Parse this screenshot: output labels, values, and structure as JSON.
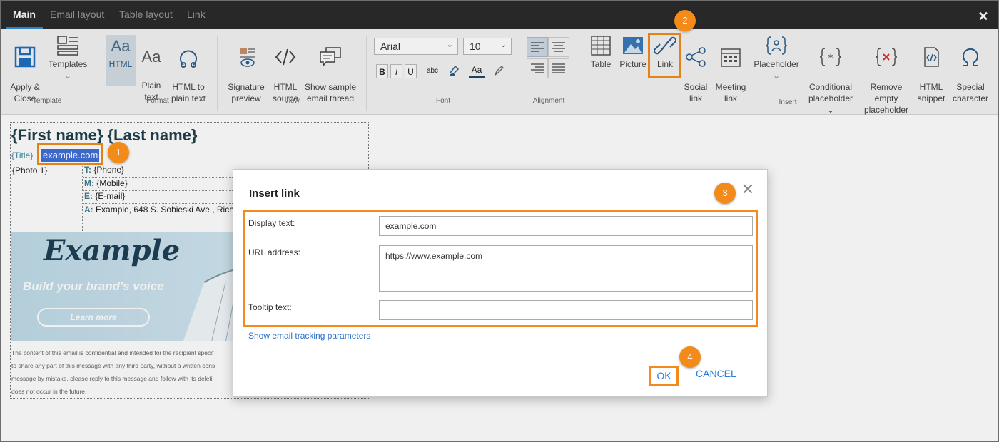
{
  "tabs": [
    {
      "label": "Main"
    },
    {
      "label": "Email layout"
    },
    {
      "label": "Table layout"
    },
    {
      "label": "Link"
    }
  ],
  "close_glyph": "✕",
  "ribbon": {
    "apply_close": "Apply &\nClose",
    "templates": "Templates",
    "templates_caret": "⌄",
    "group_template": "Template",
    "html": "HTML",
    "plain_text": "Plain\ntext",
    "html_to_plain": "HTML to\nplain text",
    "group_format": "Format",
    "signature_preview": "Signature\npreview",
    "html_source": "HTML\nsource",
    "show_sample": "Show sample\nemail thread",
    "group_view": "View",
    "font_name": "Arial",
    "font_size": "10",
    "bold": "B",
    "italic": "I",
    "underline": "U",
    "strike": "abc",
    "font_color": "Aa",
    "group_font": "Font",
    "group_alignment": "Alignment",
    "table": "Table",
    "picture": "Picture",
    "link": "Link",
    "social_link": "Social\nlink",
    "meeting_link": "Meeting\nlink",
    "placeholder": "Placeholder",
    "placeholder_caret": "⌄",
    "conditional_placeholder": "Conditional\nplaceholder ⌄",
    "remove_empty_placeholder": "Remove\nempty\nplaceholder",
    "html_snippet": "HTML\nsnippet",
    "special_character": "Special\ncharacter",
    "group_insert": "Insert"
  },
  "signature": {
    "name": "{First name} {Last name}",
    "title": "{Title}",
    "link_text": "example.com",
    "photo": "{Photo 1}",
    "contacts": [
      {
        "key": "T:",
        "value": "{Phone}"
      },
      {
        "key": "M:",
        "value": "{Mobile}"
      },
      {
        "key": "E:",
        "value": "{E-mail}"
      },
      {
        "key": "A:",
        "value": "Example, 648 S. Sobieski Ave., Rich"
      }
    ],
    "banner_word": "Example",
    "banner_tagline": "Build your brand's voice",
    "banner_button": "Learn more",
    "disclaimer": "The content of this email is confidential and intended for the recipient specif\nto share any part of this message with any third party, without a written cons\nmessage by mistake, please reply to this message and follow with its deleti\ndoes not occur in the future."
  },
  "dialog": {
    "title": "Insert link",
    "close": "✕",
    "display_label": "Display text:",
    "display_value": "example.com",
    "url_label": "URL address:",
    "url_value": "https://www.example.com",
    "tooltip_label": "Tooltip text:",
    "tooltip_value": "",
    "tracking_link": "Show email tracking parameters",
    "ok": "OK",
    "cancel": "CANCEL"
  },
  "callouts": [
    "1",
    "2",
    "3",
    "4"
  ],
  "colors": {
    "accent_orange": "#f28b1a",
    "link_blue": "#2a7de1",
    "tab_bar": "#2b2b2b"
  }
}
